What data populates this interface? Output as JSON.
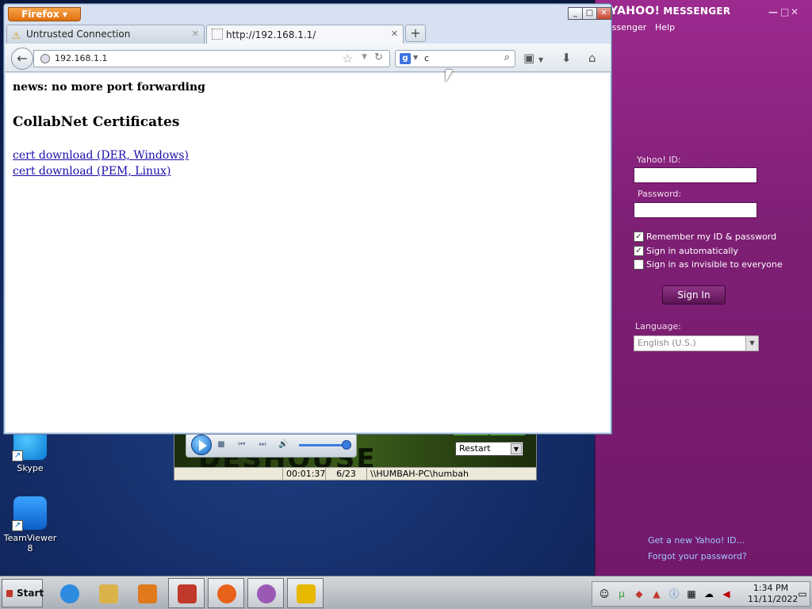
{
  "desktop": {
    "icons": [
      {
        "label": "Skype",
        "icon": "skype-icon"
      },
      {
        "label": "TeamViewer 8",
        "icon": "teamviewer-icon"
      }
    ]
  },
  "media_player": {
    "art_text": "DESHOUSE",
    "action_select": "Restart",
    "elapsed": "00:01:37",
    "track": "6/23",
    "path": "\\\\HUMBAH-PC\\humbah"
  },
  "yahoo": {
    "title_brand": "YAHOO!",
    "title_product": "MESSENGER",
    "menu": [
      "essenger",
      "Help"
    ],
    "id_label": "Yahoo! ID:",
    "id_value": "",
    "password_label": "Password:",
    "password_value": "",
    "remember_label": "Remember my ID & password",
    "remember_checked": true,
    "auto_label": "Sign in automatically",
    "auto_checked": true,
    "invisible_label": "Sign in as invisible to everyone",
    "invisible_checked": false,
    "sign_in": "Sign In",
    "language_label": "Language:",
    "language_value": "English (U.S.)",
    "new_id_link": "Get a new Yahoo! ID...",
    "forgot_link": "Forgot your password?"
  },
  "firefox": {
    "app_button": "Firefox",
    "tabs": [
      {
        "label": "Untrusted Connection",
        "active": false
      },
      {
        "label": "http://192.168.1.1/",
        "active": true
      }
    ],
    "new_tab": "+",
    "url": "192.168.1.1",
    "search_query": "c",
    "search_engine_glyph": "g",
    "page": {
      "news": "news: no more port forwarding",
      "heading": "CollabNet Certificates",
      "links": [
        "cert download (DER, Windows)",
        "cert download (PEM, Linux)"
      ]
    }
  },
  "taskbar": {
    "start": "Start",
    "apps": [
      {
        "icon": "internet-explorer-icon",
        "color": "#2d8be0"
      },
      {
        "icon": "file-explorer-icon",
        "color": "#d9b24a"
      },
      {
        "icon": "media-player-icon",
        "color": "#e07a1c"
      },
      {
        "icon": "security-shield-icon",
        "color": "#c0392b"
      },
      {
        "icon": "firefox-icon",
        "color": "#e8611a"
      },
      {
        "icon": "yahoo-messenger-icon",
        "color": "#9b59b6"
      },
      {
        "icon": "puzzle-app-icon",
        "color": "#e6b800"
      }
    ],
    "clock_time": "1:34 PM",
    "clock_date": "11/11/2022"
  }
}
